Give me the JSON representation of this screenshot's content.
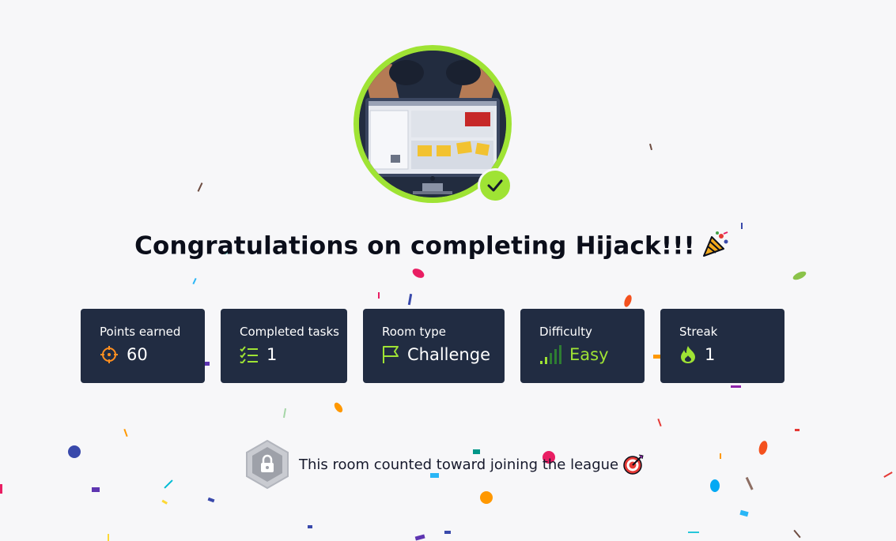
{
  "title": "Congratulations on completing Hijack!!!",
  "title_emoji": "party-popper-icon",
  "accent_color": "#9fe334",
  "card_color": "#212c42",
  "stats": [
    {
      "label": "Points earned",
      "value": "60",
      "icon": "crosshair-icon"
    },
    {
      "label": "Completed tasks",
      "value": "1",
      "icon": "task-list-icon"
    },
    {
      "label": "Room type",
      "value": "Challenge",
      "icon": "flag-icon"
    },
    {
      "label": "Difficulty",
      "value": "Easy",
      "icon": "signal-bars-icon"
    },
    {
      "label": "Streak",
      "value": "1",
      "icon": "flame-icon"
    }
  ],
  "league_text": "This room counted toward joining the league",
  "league_icon": "lock-hexagon-icon",
  "league_emoji": "bullseye-icon"
}
